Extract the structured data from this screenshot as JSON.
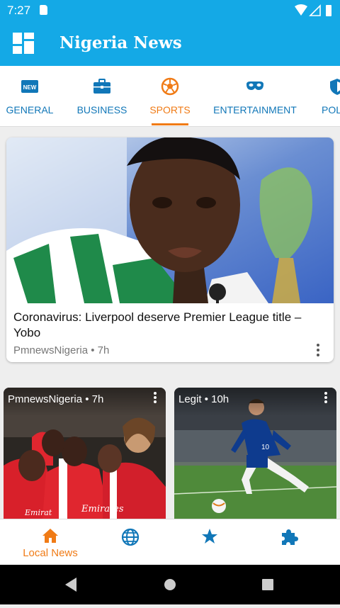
{
  "status_bar": {
    "time": "7:27"
  },
  "app_bar": {
    "title": "Nigeria News"
  },
  "tabs": [
    {
      "label": "GENERAL",
      "icon": "new-badge-icon",
      "active": false
    },
    {
      "label": "BUSINESS",
      "icon": "briefcase-icon",
      "active": false
    },
    {
      "label": "SPORTS",
      "icon": "soccer-ball-icon",
      "active": true
    },
    {
      "label": "ENTERTAINMENT",
      "icon": "mask-icon",
      "active": false
    },
    {
      "label": "POL",
      "icon": "shield-icon",
      "active": false
    }
  ],
  "featured": {
    "title": "Coronavirus: Liverpool deserve Premier League title – Yobo",
    "source": "PmnewsNigeria",
    "age": "7h"
  },
  "small_cards": [
    {
      "source": "PmnewsNigeria",
      "age": "7h"
    },
    {
      "source": "Legit",
      "age": "10h"
    }
  ],
  "bottom_nav": [
    {
      "label": "Local News",
      "icon": "home-icon",
      "active": true
    },
    {
      "label": "",
      "icon": "globe-icon",
      "active": false
    },
    {
      "label": "",
      "icon": "star-icon",
      "active": false
    },
    {
      "label": "",
      "icon": "puzzle-icon",
      "active": false
    }
  ],
  "colors": {
    "primary": "#14a9e6",
    "accent": "#f07b16",
    "tab_text": "#1177b8"
  }
}
